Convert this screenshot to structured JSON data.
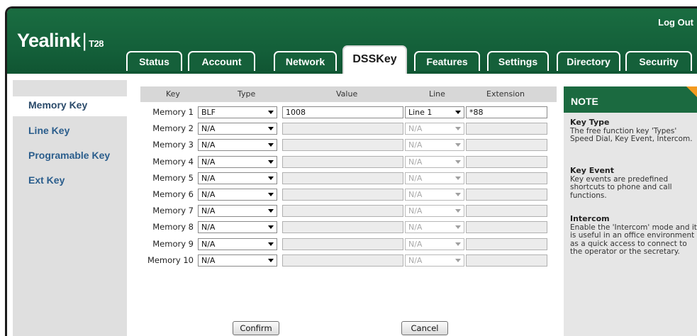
{
  "header": {
    "logo_brand": "Yealink",
    "logo_sep": "|",
    "logo_model": "T28",
    "logout": "Log Out"
  },
  "tabs": [
    "Status",
    "Account",
    "Network",
    "DSSKey",
    "Features",
    "Settings",
    "Directory",
    "Security"
  ],
  "active_tab": "DSSKey",
  "sidebar": {
    "items": [
      "Memory Key",
      "Line Key",
      "Programable Key",
      "Ext Key"
    ],
    "active": "Memory Key"
  },
  "table": {
    "headers": {
      "key": "Key",
      "type": "Type",
      "value": "Value",
      "line": "Line",
      "extension": "Extension"
    },
    "rows": [
      {
        "key": "Memory 1",
        "type": "BLF",
        "value": "1008",
        "line": "Line 1",
        "extension": "*88",
        "enabled": true
      },
      {
        "key": "Memory 2",
        "type": "N/A",
        "value": "",
        "line": "N/A",
        "extension": "",
        "enabled": false
      },
      {
        "key": "Memory 3",
        "type": "N/A",
        "value": "",
        "line": "N/A",
        "extension": "",
        "enabled": false
      },
      {
        "key": "Memory 4",
        "type": "N/A",
        "value": "",
        "line": "N/A",
        "extension": "",
        "enabled": false
      },
      {
        "key": "Memory 5",
        "type": "N/A",
        "value": "",
        "line": "N/A",
        "extension": "",
        "enabled": false
      },
      {
        "key": "Memory 6",
        "type": "N/A",
        "value": "",
        "line": "N/A",
        "extension": "",
        "enabled": false
      },
      {
        "key": "Memory 7",
        "type": "N/A",
        "value": "",
        "line": "N/A",
        "extension": "",
        "enabled": false
      },
      {
        "key": "Memory 8",
        "type": "N/A",
        "value": "",
        "line": "N/A",
        "extension": "",
        "enabled": false
      },
      {
        "key": "Memory 9",
        "type": "N/A",
        "value": "",
        "line": "N/A",
        "extension": "",
        "enabled": false
      },
      {
        "key": "Memory 10",
        "type": "N/A",
        "value": "",
        "line": "N/A",
        "extension": "",
        "enabled": false
      }
    ]
  },
  "buttons": {
    "confirm": "Confirm",
    "cancel": "Cancel"
  },
  "note": {
    "title": "NOTE",
    "sections": [
      {
        "heading": "Key Type",
        "text": "The free function key 'Types' Speed Dial, Key Event, Intercom."
      },
      {
        "heading": "Key Event",
        "text": "Key events are predefined shortcuts to phone and call functions."
      },
      {
        "heading": "Intercom",
        "text": "Enable the 'Intercom' mode and it is useful in an office environment as a quick access to connect to the operator or the secretary."
      }
    ]
  },
  "colors": {
    "header_green": "#14603a",
    "note_corner": "#f39a1f",
    "sidebar_link": "#2a5d8c"
  }
}
